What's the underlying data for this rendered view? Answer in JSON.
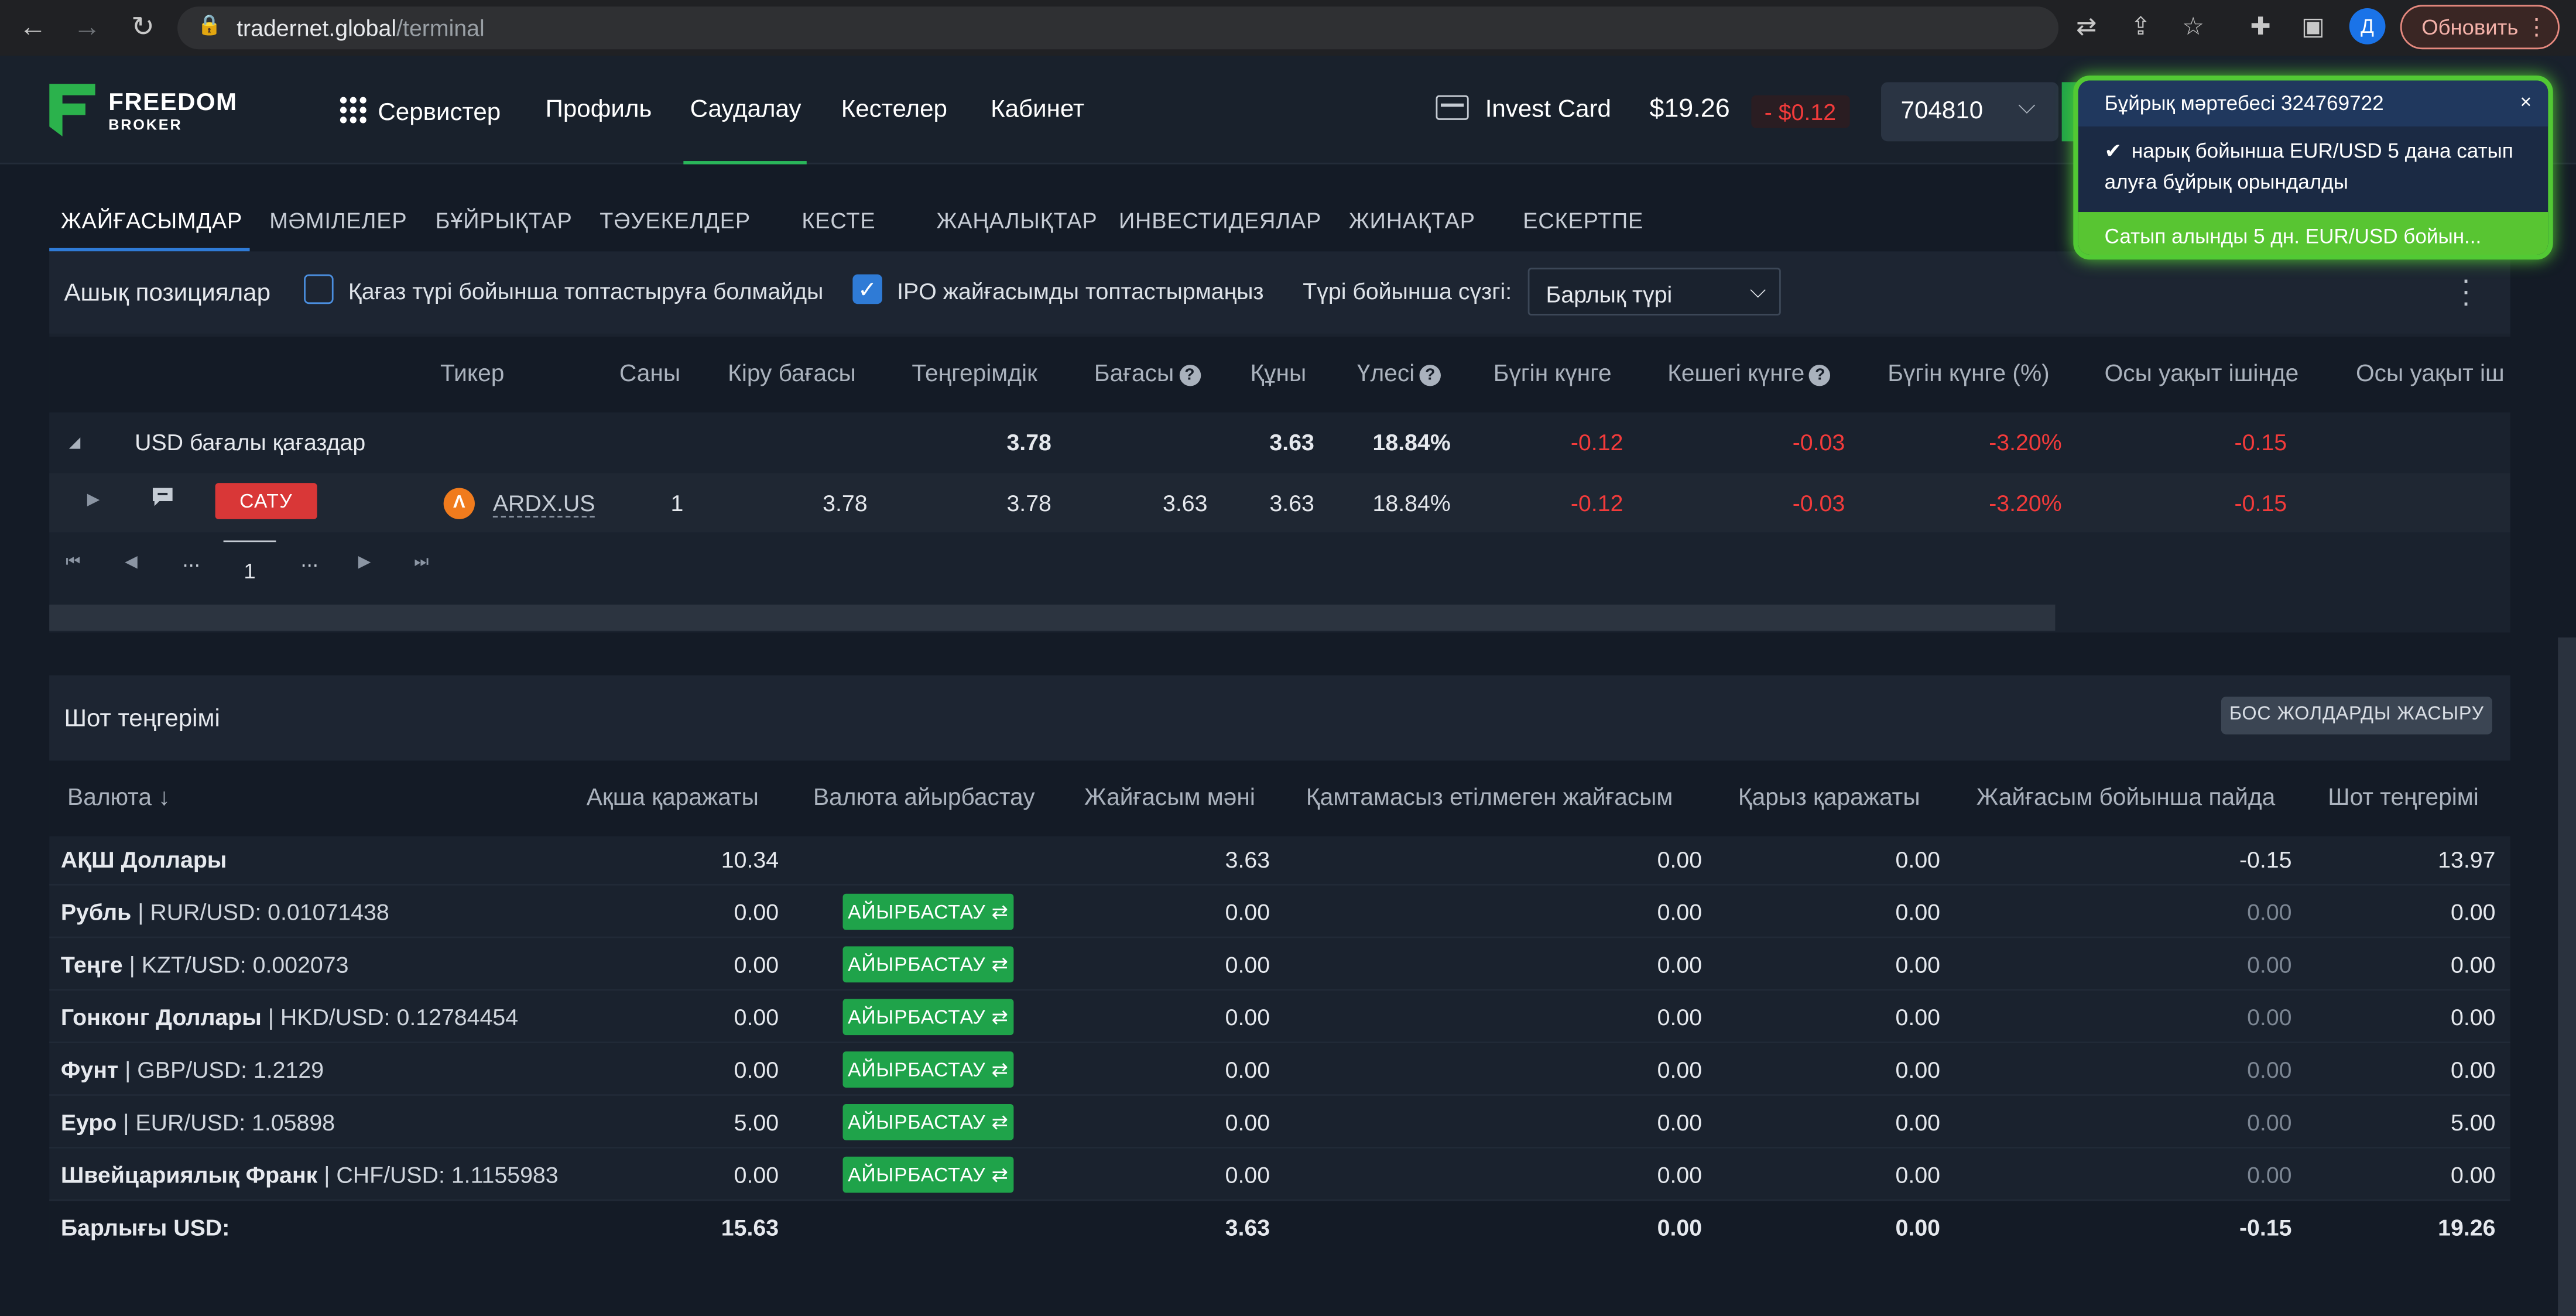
{
  "browser": {
    "url_host": "tradernet.global",
    "url_path": "/terminal",
    "avatar_letter": "Д",
    "update_label": "Обновить"
  },
  "header": {
    "logo_line1": "FREEDOM",
    "logo_line2": "BROKER",
    "menu": [
      "Сервистер",
      "Профиль",
      "Саудалау",
      "Кестелер",
      "Кабинет"
    ],
    "active_menu": "Саудалау",
    "invest_card": "Invest Card",
    "balance": "$19.26",
    "change": "- $0.12",
    "account": "704810"
  },
  "tabs": [
    "ЖАЙҒАСЫМДАР",
    "МӘМІЛЕЛЕР",
    "БҰЙРЫҚТАР",
    "ТӘУЕКЕЛДЕР",
    "КЕСТЕ",
    "ЖАҢАЛЫҚТАР",
    "ИНВЕСТИДЕЯЛАР",
    "ЖИНАҚТАР",
    "ЕСКЕРТПЕ"
  ],
  "positions": {
    "title": "Ашық позициялар",
    "checkbox1": "Қағаз түрі бойынша топтастыруға болмайды",
    "checkbox2": "IPO жайғасымды топтастырмаңыз",
    "filter_label": "Түрі бойынша сүзгі:",
    "filter_value": "Барлық түрі",
    "columns": [
      "Тикер",
      "Саны",
      "Кіру бағасы",
      "Теңгерімдік",
      "Бағасы",
      "Құны",
      "Үлесі",
      "Бүгін күнге",
      "Кешегі күнге",
      "Бүгін күнге (%)",
      "Осы уақыт ішінде",
      "Осы уақыт іш"
    ],
    "group": {
      "label": "USD бағалы қағаздар",
      "balance": "3.78",
      "cost": "3.63",
      "share": "18.84%",
      "today": "-0.12",
      "yesterday": "-0.03",
      "today_pct": "-3.20%",
      "all_time": "-0.15"
    },
    "row": {
      "action": "САТУ",
      "ticker": "ARDX.US",
      "qty": "1",
      "entry": "3.78",
      "balance": "3.78",
      "price": "3.63",
      "cost": "3.63",
      "share": "18.84%",
      "today": "-0.12",
      "yesterday": "-0.03",
      "today_pct": "-3.20%",
      "all_time": "-0.15"
    },
    "pager": {
      "ellipsis": "...",
      "page": "1"
    }
  },
  "account_balance": {
    "title": "Шот теңгерімі",
    "hide_button": "БОС ЖОЛДАРДЫ ЖАСЫРУ",
    "columns": [
      "Валюта ↓",
      "Ақша қаражаты",
      "Валюта айырбастау",
      "Жайғасым мәні",
      "Қамтамасыз етілмеген жайғасым",
      "Қарыз қаражаты",
      "Жайғасым бойынша пайда",
      "Шот теңгерімі"
    ],
    "exchange_label": "АЙЫРБАСТАУ ⇄",
    "rows": [
      {
        "name": "АҚШ Доллары",
        "rate": "",
        "cash": "10.34",
        "position": "3.63",
        "unsecured": "0.00",
        "debt": "0.00",
        "profit": "-0.15",
        "total": "13.97"
      },
      {
        "name": "Рубль",
        "rate": " | RUR/USD: 0.01071438",
        "cash": "0.00",
        "position": "0.00",
        "unsecured": "0.00",
        "debt": "0.00",
        "profit": "0.00",
        "total": "0.00"
      },
      {
        "name": "Теңге",
        "rate": " | KZT/USD: 0.002073",
        "cash": "0.00",
        "position": "0.00",
        "unsecured": "0.00",
        "debt": "0.00",
        "profit": "0.00",
        "total": "0.00"
      },
      {
        "name": "Гонконг Доллары",
        "rate": " | HKD/USD: 0.12784454",
        "cash": "0.00",
        "position": "0.00",
        "unsecured": "0.00",
        "debt": "0.00",
        "profit": "0.00",
        "total": "0.00"
      },
      {
        "name": "Фунт",
        "rate": " | GBP/USD: 1.2129",
        "cash": "0.00",
        "position": "0.00",
        "unsecured": "0.00",
        "debt": "0.00",
        "profit": "0.00",
        "total": "0.00"
      },
      {
        "name": "Еуро",
        "rate": " | EUR/USD: 1.05898",
        "cash": "5.00",
        "position": "0.00",
        "unsecured": "0.00",
        "debt": "0.00",
        "profit": "0.00",
        "total": "5.00"
      },
      {
        "name": "Швейцариялық Франк",
        "rate": " | CHF/USD: 1.1155983",
        "cash": "0.00",
        "position": "0.00",
        "unsecured": "0.00",
        "debt": "0.00",
        "profit": "0.00",
        "total": "0.00"
      }
    ],
    "total": {
      "name": "Барлығы USD:",
      "cash": "15.63",
      "position": "3.63",
      "unsecured": "0.00",
      "debt": "0.00",
      "profit": "-0.15",
      "total": "19.26"
    }
  },
  "notification": {
    "title": "Бұйрық мәртебесі 324769722",
    "close": "×",
    "message": "нарық бойынша EUR/USD 5 дана сатып алуға бұйрық орындалды",
    "footer": "Сатып алынды 5 дн. EUR/USD бойын..."
  },
  "colors": {
    "accent_green": "#1fa34a",
    "negative": "#f33b3b",
    "sell": "#d93737",
    "tab_active": "#2f7bd6"
  }
}
